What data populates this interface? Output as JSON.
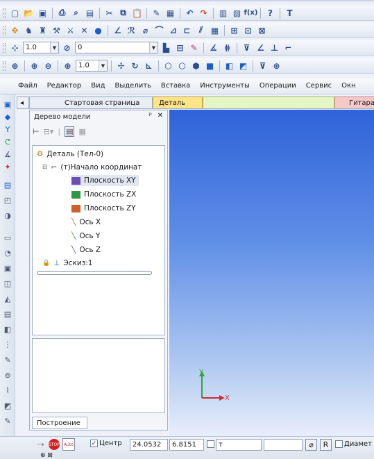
{
  "toolbar3": {
    "scale1": "1.0",
    "layer": "0"
  },
  "toolbar4": {
    "zoom": "1.0"
  },
  "menu": [
    "Файл",
    "Редактор",
    "Вид",
    "Выделить",
    "Вставка",
    "Инструменты",
    "Операции",
    "Сервис",
    "Окн"
  ],
  "tabs": {
    "start": "Стартовая страница",
    "detail": "Деталь",
    "guitar": "Гитара"
  },
  "panel": {
    "title": "Дерево модели",
    "pin": "ᵖ",
    "close": "✕",
    "bottom_tab": "Построение"
  },
  "tree": {
    "root": "Деталь (Тел-0)",
    "origin": "(т)Начало координат",
    "plane_xy": "Плоскость XY",
    "plane_zx": "Плоскость ZX",
    "plane_zy": "Плоскость ZY",
    "axis_x": "Ось X",
    "axis_y": "Ось Y",
    "axis_z": "Ось Z",
    "sketch": "Эскиз:1"
  },
  "axes": {
    "x": "X",
    "y": "Y"
  },
  "status": {
    "center_label": "Центр",
    "center_x": "24.0532",
    "center_y": "6.8151",
    "field3_label": "т",
    "r_label": "R",
    "diameter_label": "Диамет"
  },
  "colors": {
    "plane_xy": "#6a4fb0",
    "plane_zx": "#2e9a48",
    "plane_zy": "#d0602c",
    "axis_y": "#2fa43a",
    "axis_x": "#c83232"
  }
}
